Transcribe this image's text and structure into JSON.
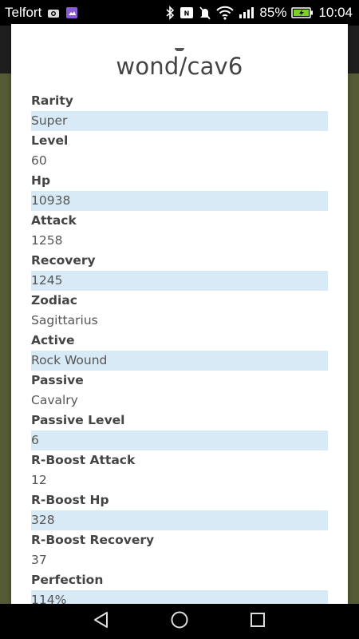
{
  "status_bar": {
    "carrier": "Telfort",
    "battery_percent": "85%",
    "time": "10:04",
    "icons": [
      "camera-icon",
      "gallery-icon",
      "bluetooth-icon",
      "nfc-icon",
      "mute-icon",
      "wifi-icon",
      "signal-icon",
      "battery-icon"
    ]
  },
  "modal": {
    "title": "wond/cav6",
    "properties": [
      {
        "label": "Rarity",
        "value": "Super"
      },
      {
        "label": "Level",
        "value": "60"
      },
      {
        "label": "Hp",
        "value": "10938"
      },
      {
        "label": "Attack",
        "value": "1258"
      },
      {
        "label": "Recovery",
        "value": "1245"
      },
      {
        "label": "Zodiac",
        "value": "Sagittarius"
      },
      {
        "label": "Active",
        "value": "Rock Wound"
      },
      {
        "label": "Passive",
        "value": "Cavalry"
      },
      {
        "label": "Passive Level",
        "value": "6"
      },
      {
        "label": "R-Boost Attack",
        "value": "12"
      },
      {
        "label": "R-Boost Hp",
        "value": "328"
      },
      {
        "label": "R-Boost Recovery",
        "value": "37"
      },
      {
        "label": "Perfection",
        "value": "114%"
      }
    ]
  },
  "nav_bar": {
    "icons": [
      "back-icon",
      "home-icon",
      "recents-icon"
    ]
  },
  "colors": {
    "shaded_row": "#d8eaf5",
    "background_app": "#555b35"
  }
}
